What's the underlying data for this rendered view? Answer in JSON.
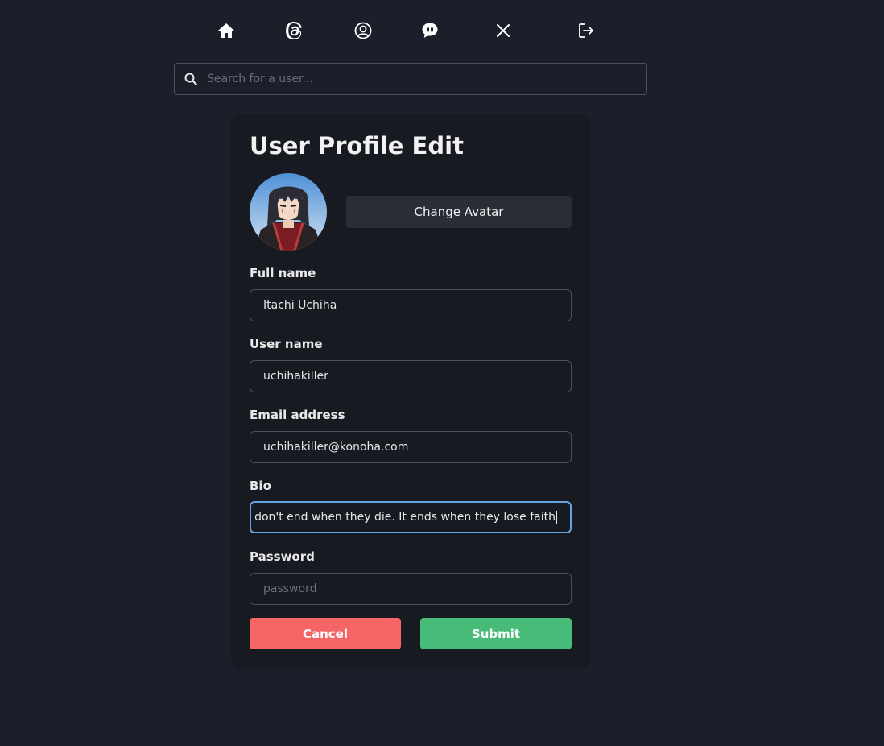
{
  "nav": {
    "items": [
      {
        "icon": "home-icon"
      },
      {
        "icon": "threads-icon"
      },
      {
        "icon": "profile-icon"
      },
      {
        "icon": "chat-icon"
      },
      {
        "icon": "x-icon"
      },
      {
        "icon": "logout-icon"
      }
    ]
  },
  "search": {
    "placeholder": "Search for a user..."
  },
  "form": {
    "title": "User Profile Edit",
    "change_avatar_label": "Change Avatar",
    "full_name": {
      "label": "Full name",
      "value": "Itachi Uchiha"
    },
    "user_name": {
      "label": "User name",
      "value": "uchihakiller"
    },
    "email": {
      "label": "Email address",
      "value": "uchihakiller@konoha.com"
    },
    "bio": {
      "label": "Bio",
      "visible_value": "don't end when they die. It ends when they lose faith"
    },
    "password": {
      "label": "Password",
      "placeholder": "password",
      "value": ""
    },
    "cancel_label": "Cancel",
    "submit_label": "Submit"
  },
  "colors": {
    "background": "#1b1f2a",
    "card": "#171a21",
    "cancel": "#f56565",
    "submit": "#48bb78",
    "focus_ring": "#63a4e0"
  }
}
